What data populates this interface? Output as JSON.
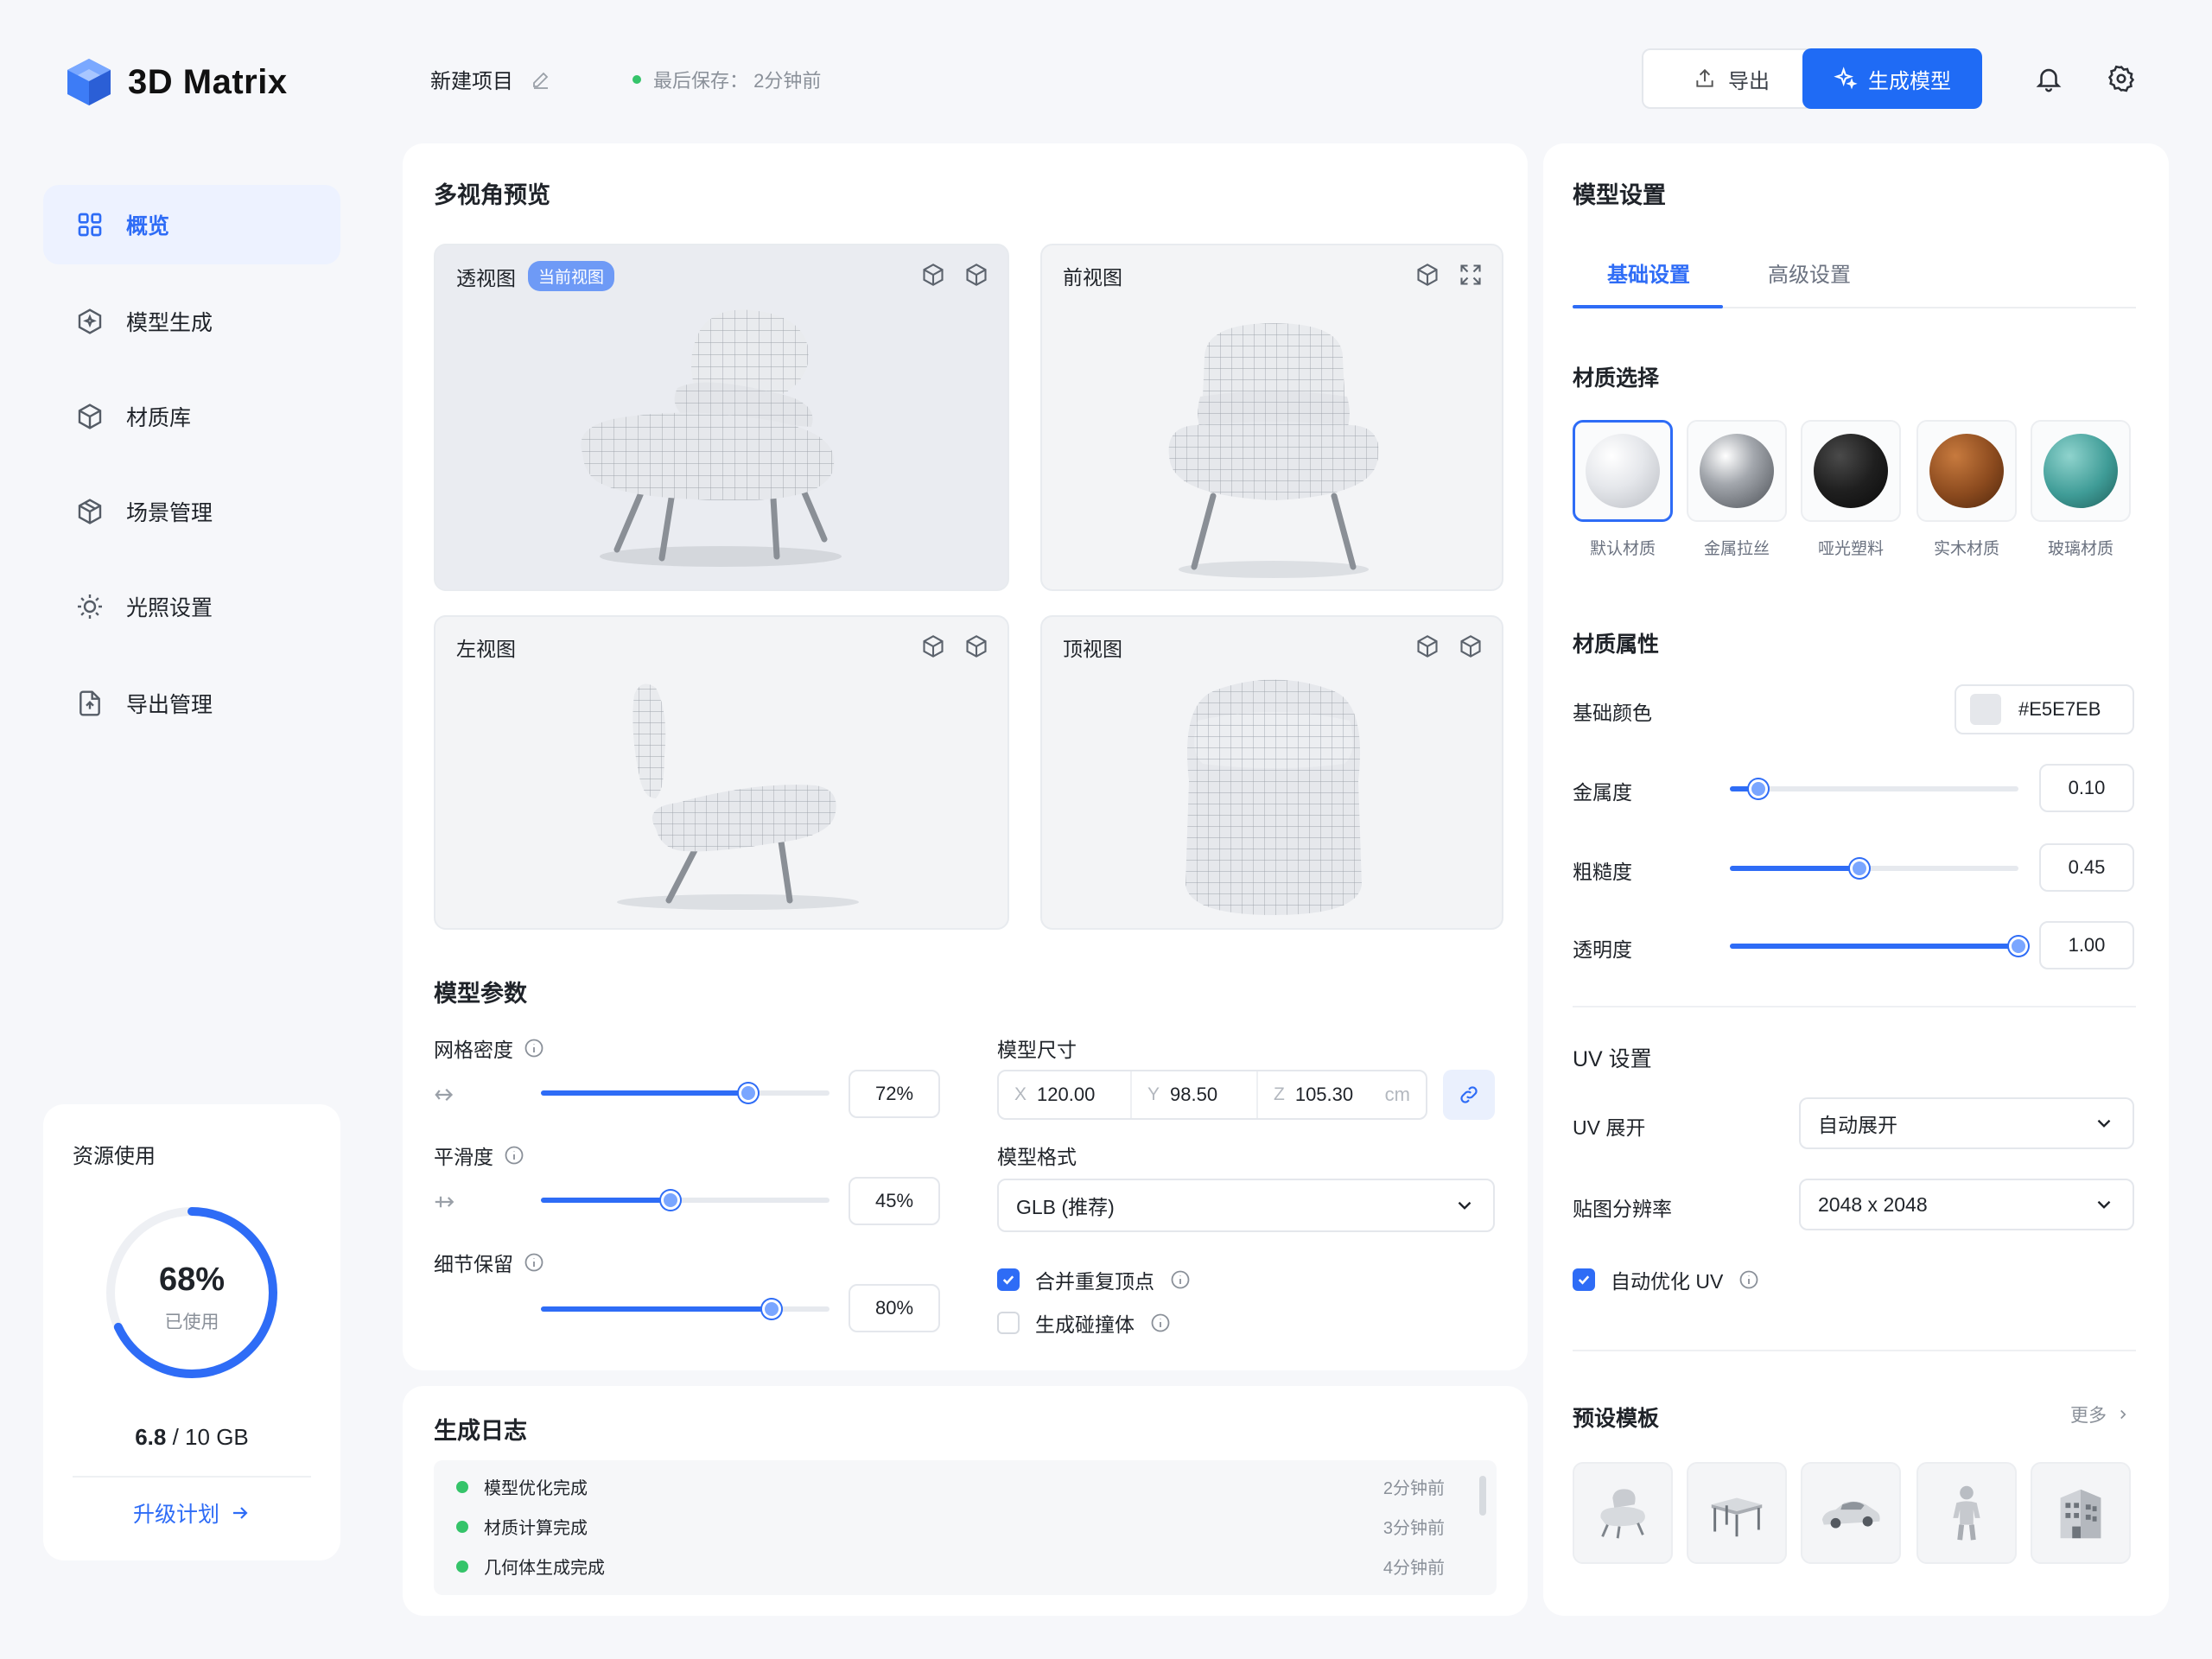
{
  "app": {
    "name": "3D Matrix"
  },
  "sidebar": {
    "items": [
      {
        "label": "概览",
        "icon": "grid-icon",
        "active": true
      },
      {
        "label": "模型生成",
        "icon": "cube-sparkle-icon",
        "active": false
      },
      {
        "label": "材质库",
        "icon": "cube-icon",
        "active": false
      },
      {
        "label": "场景管理",
        "icon": "box-icon",
        "active": false
      },
      {
        "label": "光照设置",
        "icon": "sun-icon",
        "active": false
      },
      {
        "label": "导出管理",
        "icon": "export-file-icon",
        "active": false
      }
    ],
    "resources": {
      "title": "资源使用",
      "percent": "68%",
      "percent_value": 0.68,
      "used_label": "已使用",
      "used": "6.8",
      "total": "/ 10 GB",
      "upgrade": "升级计划"
    }
  },
  "header": {
    "project_name": "新建项目",
    "saved_text": "最后保存： 2分钟前",
    "export_label": "导出",
    "generate_label": "生成模型"
  },
  "preview": {
    "title": "多视角预览",
    "views": [
      {
        "label": "透视图",
        "badge": "当前视图"
      },
      {
        "label": "前视图"
      },
      {
        "label": "左视图"
      },
      {
        "label": "顶视图"
      }
    ]
  },
  "params": {
    "title": "模型参数",
    "mesh_density": {
      "label": "网格密度",
      "value": "72%",
      "level": 0.72
    },
    "smoothness": {
      "label": "平滑度",
      "value": "45%",
      "level": 0.45
    },
    "detail": {
      "label": "细节保留",
      "value": "80%",
      "level": 0.8
    },
    "size": {
      "label": "模型尺寸",
      "x_axis": "X",
      "x": "120.00",
      "y_axis": "Y",
      "y": "98.50",
      "z_axis": "Z",
      "z": "105.30",
      "unit": "cm"
    },
    "format": {
      "label": "模型格式",
      "value": "GLB (推荐)"
    },
    "merge_vertices": {
      "label": "合并重复顶点",
      "checked": true
    },
    "collision": {
      "label": "生成碰撞体",
      "checked": false
    }
  },
  "log": {
    "title": "生成日志",
    "entries": [
      {
        "text": "模型优化完成",
        "time": "2分钟前"
      },
      {
        "text": "材质计算完成",
        "time": "3分钟前"
      },
      {
        "text": "几何体生成完成",
        "time": "4分钟前"
      }
    ]
  },
  "settings": {
    "title": "模型设置",
    "tabs": [
      "基础设置",
      "高级设置"
    ],
    "material_title": "材质选择",
    "materials": [
      {
        "label": "默认材质",
        "color": "#E5E7EB"
      },
      {
        "label": "金属拉丝",
        "color": "#9CA3AF"
      },
      {
        "label": "哑光塑料",
        "color": "#1F1F1F"
      },
      {
        "label": "实木材质",
        "color": "#8B4A1E"
      },
      {
        "label": "玻璃材质",
        "color": "#3F9C97"
      }
    ],
    "props_title": "材质属性",
    "base_color": {
      "label": "基础颜色",
      "value": "#E5E7EB"
    },
    "metalness": {
      "label": "金属度",
      "value": "0.10",
      "level": 0.1
    },
    "roughness": {
      "label": "粗糙度",
      "value": "0.45",
      "level": 0.45
    },
    "opacity": {
      "label": "透明度",
      "value": "1.00",
      "level": 1.0
    },
    "uv_title": "UV 设置",
    "uv_unwrap": {
      "label": "UV 展开",
      "value": "自动展开"
    },
    "texture_res": {
      "label": "贴图分辨率",
      "value": "2048 x 2048"
    },
    "auto_uv": {
      "label": "自动优化 UV",
      "checked": true
    },
    "templates_title": "预设模板",
    "more": "更多",
    "templates": [
      "chair-template",
      "table-template",
      "car-template",
      "figure-template",
      "building-template"
    ]
  },
  "colors": {
    "accent": "#2E6CF6",
    "success": "#35C46A"
  }
}
